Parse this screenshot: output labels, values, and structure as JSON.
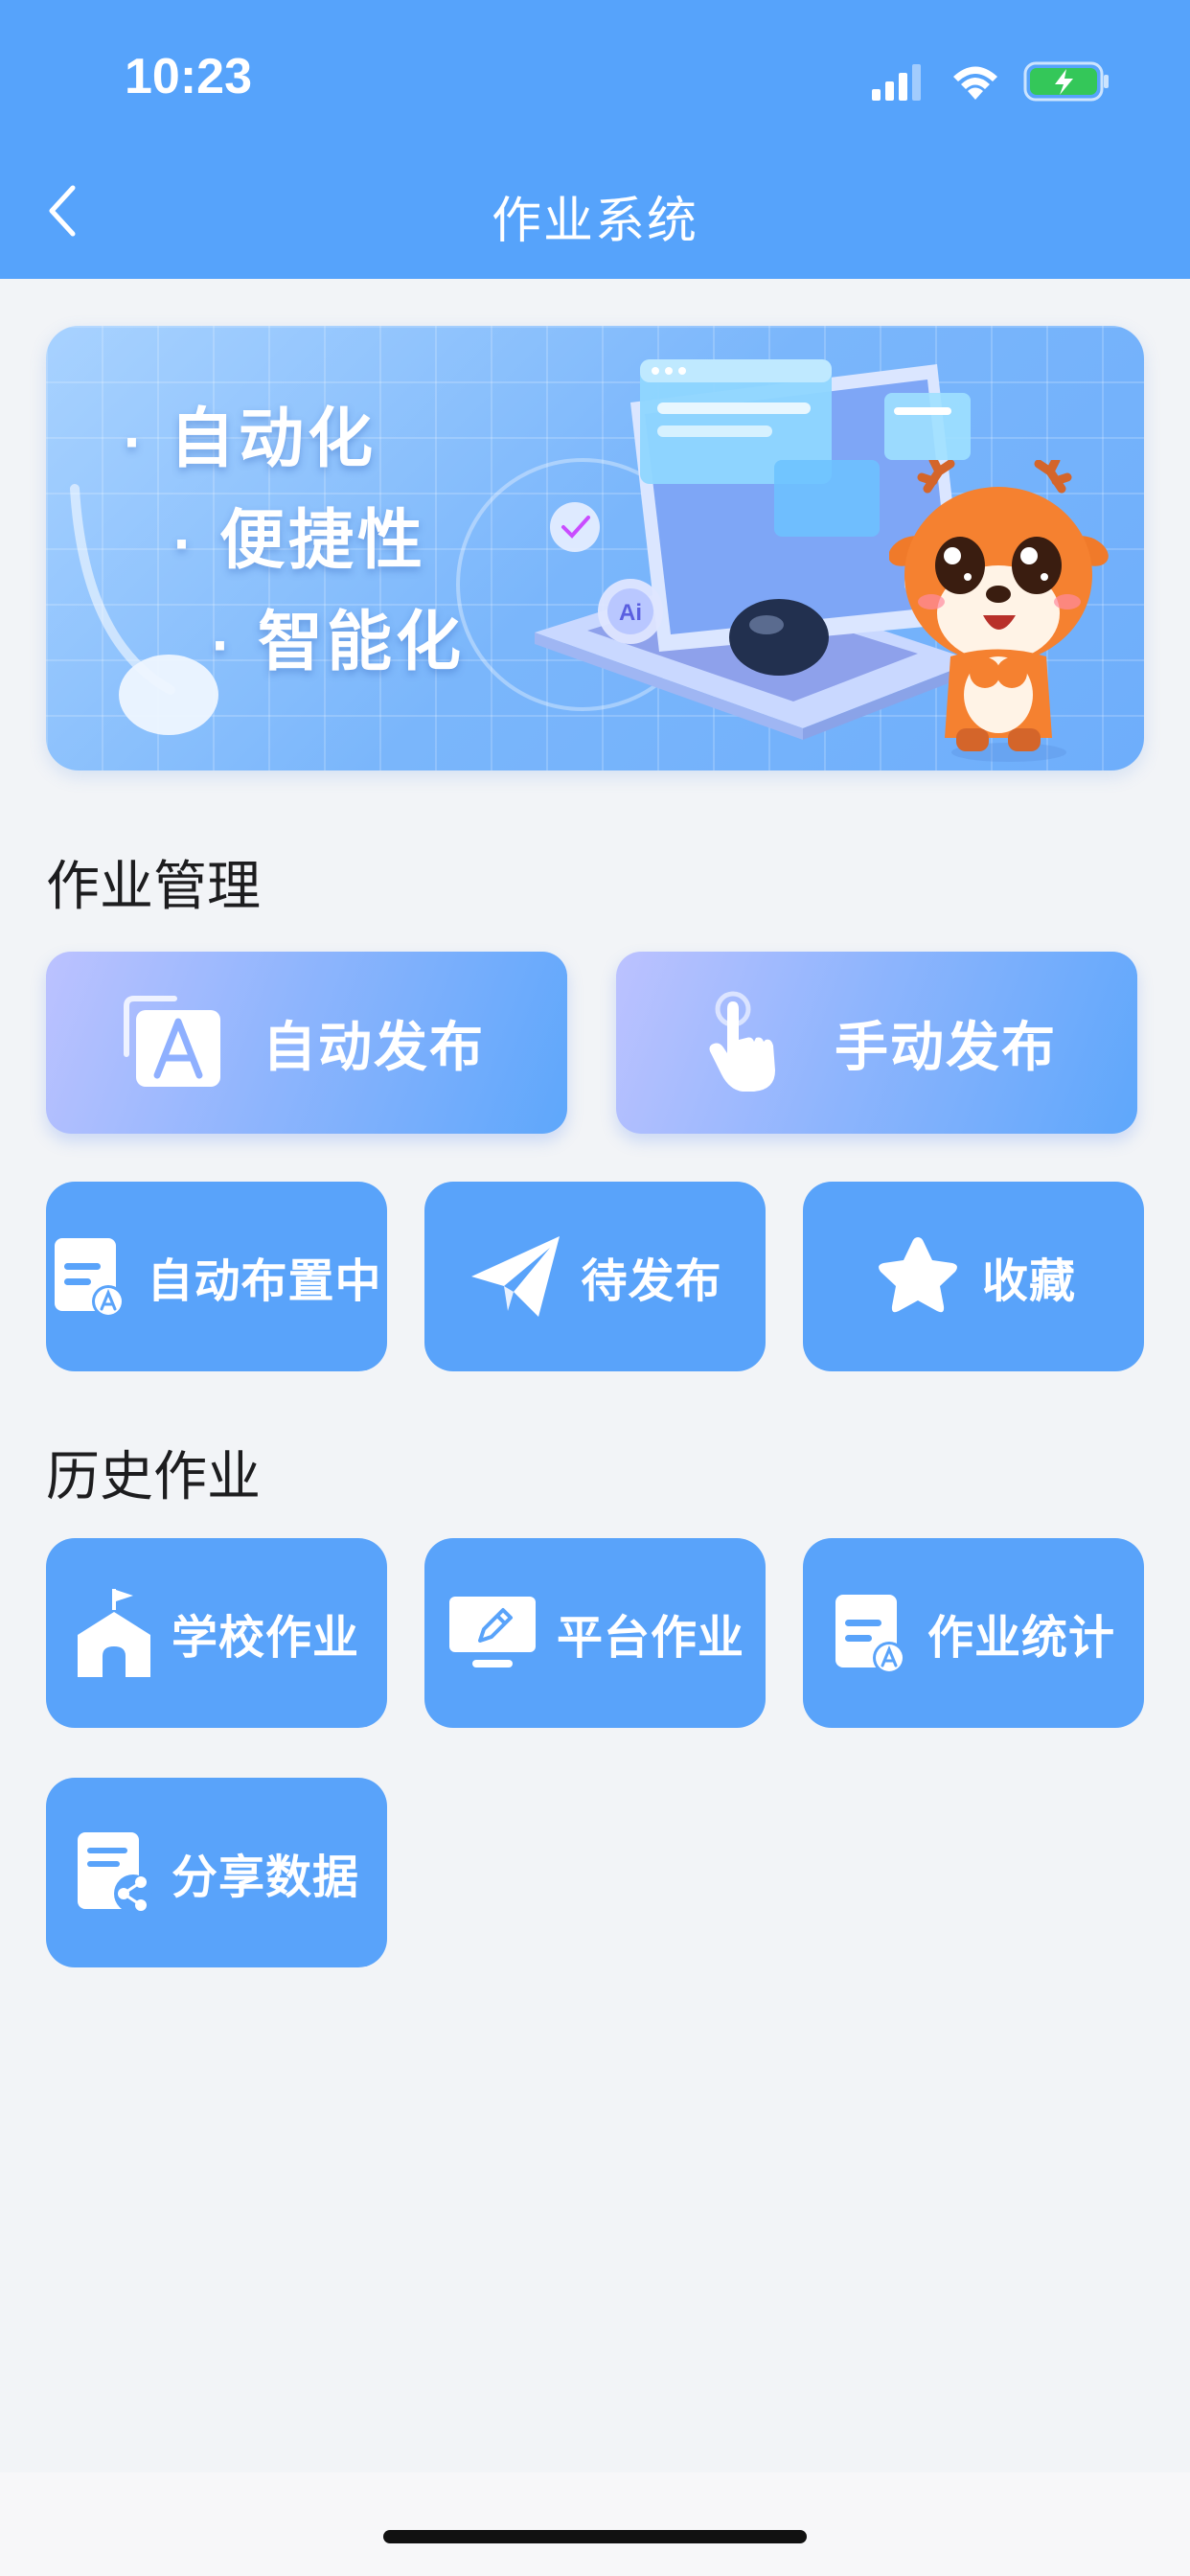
{
  "status_bar": {
    "time": "10:23"
  },
  "nav": {
    "title": "作业系统"
  },
  "banner": {
    "slogans": [
      "自动化",
      "便捷性",
      "智能化"
    ],
    "ai_badge": "Ai"
  },
  "homework_management": {
    "title": "作业管理",
    "primary_actions": [
      {
        "label": "自动发布",
        "icon": "auto-publish-icon"
      },
      {
        "label": "手动发布",
        "icon": "hand-tap-icon"
      }
    ],
    "secondary_actions": [
      {
        "label": "自动布置中",
        "icon": "document-a-icon"
      },
      {
        "label": "待发布",
        "icon": "paper-plane-icon"
      },
      {
        "label": "收藏",
        "icon": "star-icon"
      }
    ]
  },
  "history": {
    "title": "历史作业",
    "items": [
      {
        "label": "学校作业",
        "icon": "school-icon"
      },
      {
        "label": "平台作业",
        "icon": "monitor-pen-icon"
      },
      {
        "label": "作业统计",
        "icon": "document-a-icon"
      },
      {
        "label": "分享数据",
        "icon": "share-document-icon"
      }
    ]
  },
  "colors": {
    "primary": "#56a3fb",
    "tile": "#59a3fa",
    "background": "#f2f4f7",
    "battery_green": "#34c759"
  }
}
